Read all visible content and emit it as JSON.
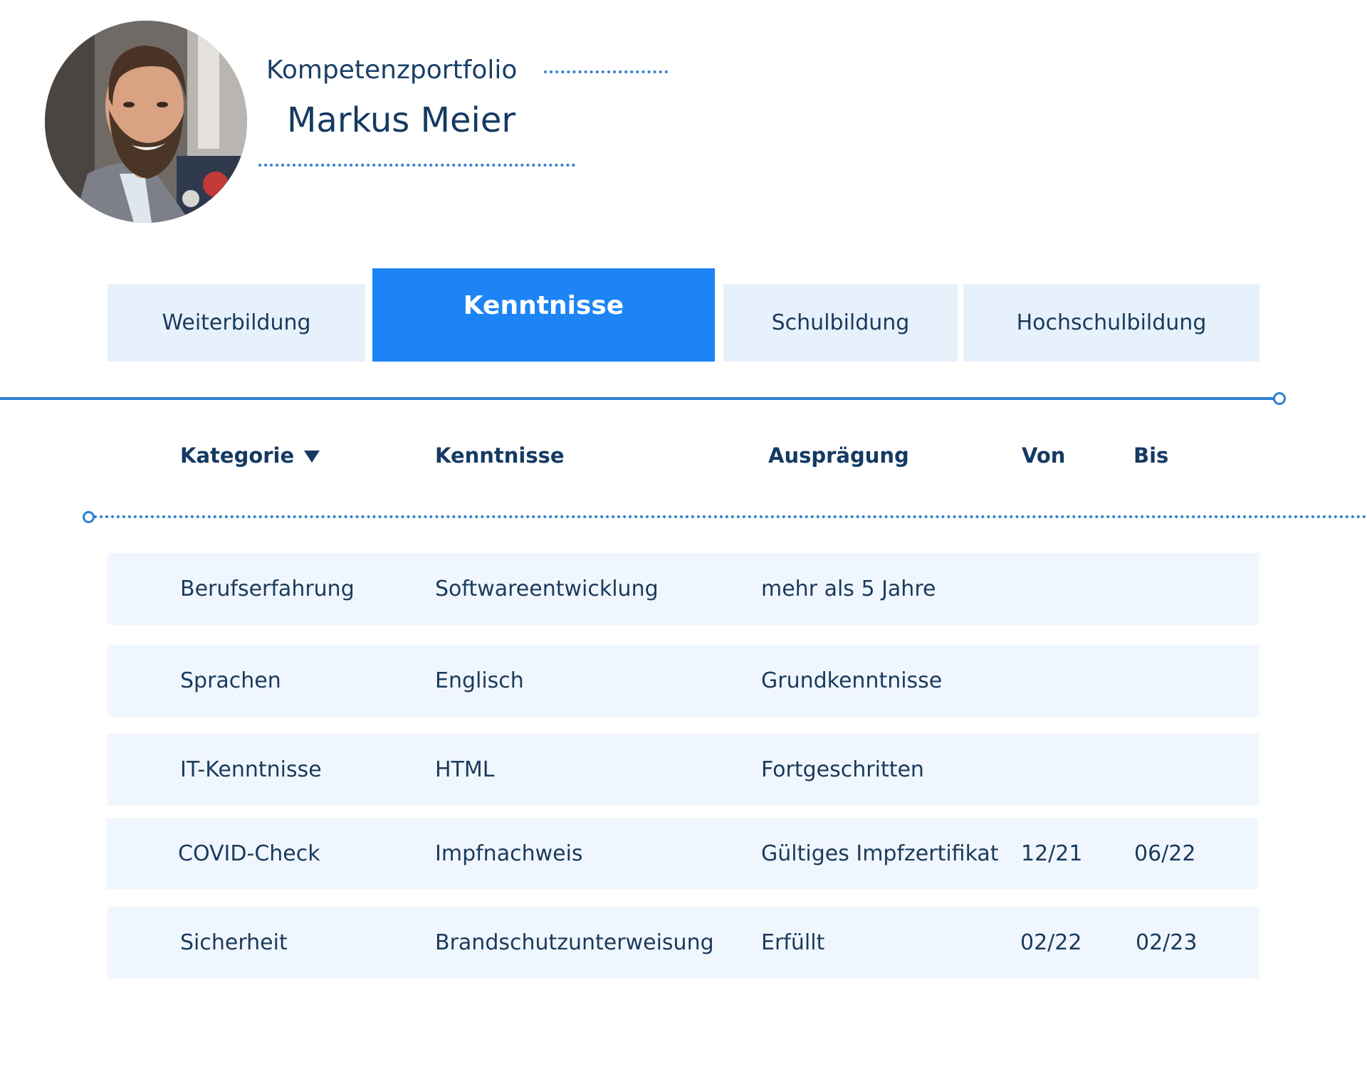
{
  "header": {
    "subtitle": "Kompetenzportfolio",
    "name": "Markus Meier"
  },
  "tabs": [
    {
      "label": "Weiterbildung",
      "active": false
    },
    {
      "label": "Kenntnisse",
      "active": true
    },
    {
      "label": "Schulbildung",
      "active": false
    },
    {
      "label": "Hochschulbildung",
      "active": false
    }
  ],
  "table": {
    "columns": [
      {
        "label": "Kategorie",
        "sortable": true,
        "sort_icon": "caret-down-icon"
      },
      {
        "label": "Kenntnisse"
      },
      {
        "label": "Ausprägung"
      },
      {
        "label": "Von"
      },
      {
        "label": "Bis"
      }
    ],
    "rows": [
      {
        "kategorie": "Berufserfahrung",
        "kenntnisse": "Softwareentwicklung",
        "auspraegung": "mehr als 5 Jahre",
        "von": "",
        "bis": ""
      },
      {
        "kategorie": "Sprachen",
        "kenntnisse": "Englisch",
        "auspraegung": "Grundkenntnisse",
        "von": "",
        "bis": ""
      },
      {
        "kategorie": "IT-Kenntnisse",
        "kenntnisse": "HTML",
        "auspraegung": "Fortgeschritten",
        "von": "",
        "bis": ""
      },
      {
        "kategorie": "COVID-Check",
        "kenntnisse": "Impfnachweis",
        "auspraegung": "Gültiges Impfzertifikat",
        "von": "12/21",
        "bis": "06/22"
      },
      {
        "kategorie": "Sicherheit",
        "kenntnisse": "Brandschutzunterweisung",
        "auspraegung": "Erfüllt",
        "von": "02/22",
        "bis": "02/23"
      }
    ]
  },
  "colors": {
    "accent": "#1c84f4",
    "tab_inactive_bg": "#e7f1fc",
    "row_bg": "#f0f6fd",
    "rule": "#2f7fd0",
    "text_dark": "#14395f"
  }
}
